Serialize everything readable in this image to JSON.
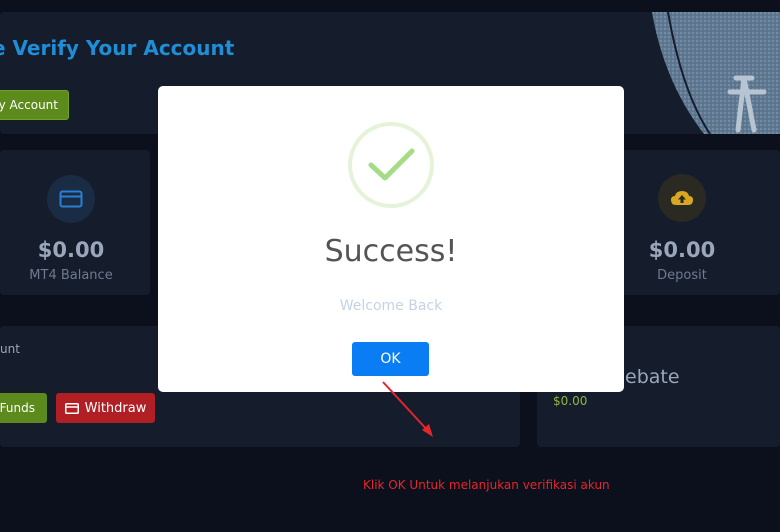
{
  "verify": {
    "title": "e Verify Your Account",
    "button_label": "y Account"
  },
  "stats": {
    "left": {
      "value": "$0.00",
      "label": "MT4 Balance",
      "icon": "card-icon"
    },
    "right": {
      "value": "$0.00",
      "label": "Deposit",
      "icon": "cloud-upload-icon"
    }
  },
  "account": {
    "label": "unt",
    "funds_label": "Funds",
    "withdraw_label": "Withdraw"
  },
  "rebate": {
    "title": "ebate",
    "value": "$0.00"
  },
  "modal": {
    "title": "Success!",
    "text": "Welcome Back",
    "ok_label": "OK"
  },
  "annotation": {
    "text": "Klik OK Untuk melanjukan verifikasi akun"
  },
  "colors": {
    "background": "#0b101c",
    "card": "#151c2c",
    "accent_blue": "#1e8fd6",
    "green_button": "#5c8a1d",
    "red_button": "#b01f24",
    "ok_button": "#0a7df5",
    "success_check": "#a5dc86",
    "annotation_red": "#e5262a"
  }
}
